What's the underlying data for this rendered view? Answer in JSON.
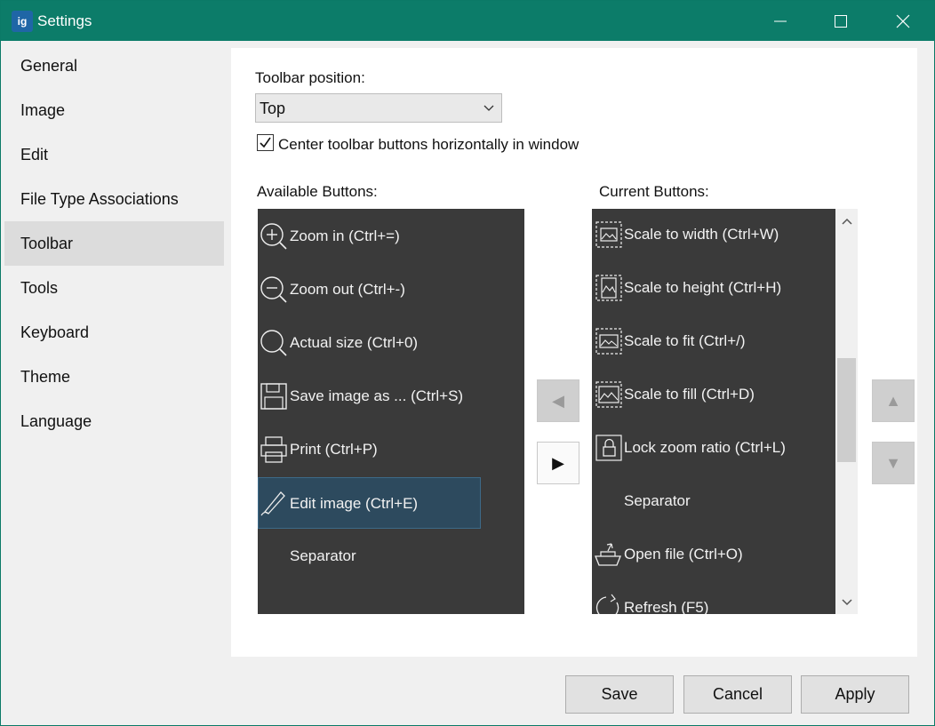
{
  "window": {
    "title": "Settings",
    "app_icon_text": "ig"
  },
  "sidebar": {
    "items": [
      {
        "label": "General"
      },
      {
        "label": "Image"
      },
      {
        "label": "Edit"
      },
      {
        "label": "File Type Associations"
      },
      {
        "label": "Toolbar"
      },
      {
        "label": "Tools"
      },
      {
        "label": "Keyboard"
      },
      {
        "label": "Theme"
      },
      {
        "label": "Language"
      }
    ],
    "active": "Toolbar"
  },
  "toolbar_page": {
    "position_label": "Toolbar position:",
    "position_value": "Top",
    "center_checkbox_label": "Center toolbar buttons horizontally in window",
    "center_checked": true,
    "available_label": "Available Buttons:",
    "current_label": "Current Buttons:",
    "available_buttons": [
      {
        "label": "Zoom in (Ctrl+=)",
        "icon": "zoom-in-icon"
      },
      {
        "label": "Zoom out (Ctrl+-)",
        "icon": "zoom-out-icon"
      },
      {
        "label": "Actual size (Ctrl+0)",
        "icon": "actual-size-icon"
      },
      {
        "label": "Save image as ... (Ctrl+S)",
        "icon": "save-icon"
      },
      {
        "label": "Print (Ctrl+P)",
        "icon": "print-icon"
      },
      {
        "label": "Edit image  (Ctrl+E)",
        "icon": "edit-icon",
        "selected": true
      },
      {
        "label": "Separator",
        "icon": ""
      }
    ],
    "current_buttons": [
      {
        "label": "Scale to width (Ctrl+W)",
        "icon": "scale-width-icon"
      },
      {
        "label": "Scale to height (Ctrl+H)",
        "icon": "scale-height-icon"
      },
      {
        "label": "Scale to fit (Ctrl+/)",
        "icon": "scale-fit-icon"
      },
      {
        "label": "Scale to fill (Ctrl+D)",
        "icon": "scale-fill-icon"
      },
      {
        "label": "Lock zoom ratio (Ctrl+L)",
        "icon": "lock-icon"
      },
      {
        "label": "Separator",
        "icon": ""
      },
      {
        "label": "Open file (Ctrl+O)",
        "icon": "open-file-icon"
      },
      {
        "label": "Refresh (F5)",
        "icon": "refresh-icon"
      }
    ],
    "move_left_glyph": "◀",
    "move_right_glyph": "▶",
    "move_up_glyph": "▲",
    "move_down_glyph": "▼"
  },
  "footer": {
    "save_label": "Save",
    "cancel_label": "Cancel",
    "apply_label": "Apply"
  },
  "colors": {
    "titlebar": "#0c7c69",
    "listbox_bg": "#3a3a3a",
    "selection": "#2d4a5e"
  }
}
